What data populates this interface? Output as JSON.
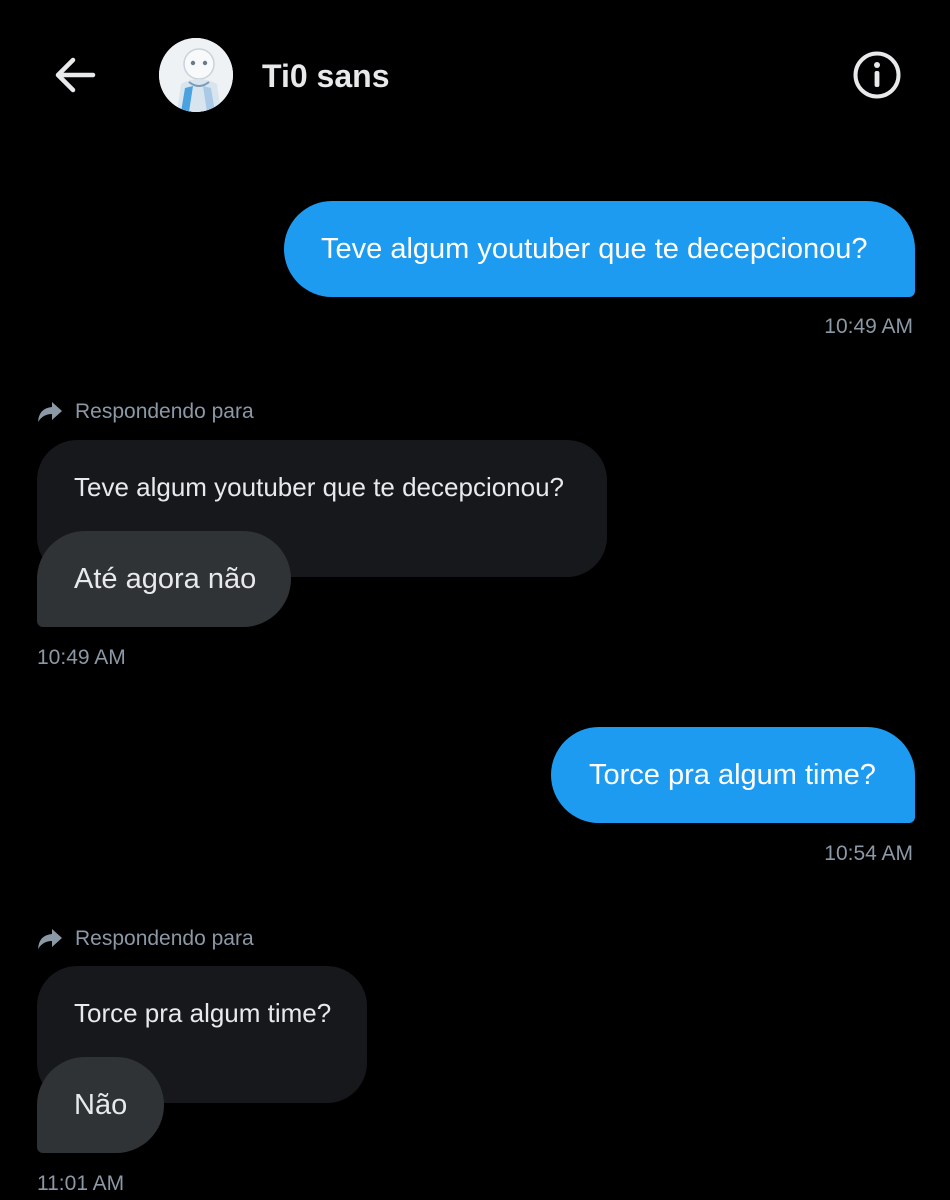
{
  "header": {
    "contact_name": "Ti0 sans",
    "back_icon": "arrow-left-icon",
    "info_icon": "info-circle-icon"
  },
  "colors": {
    "background": "#000000",
    "outgoing_bubble": "#1d9bf0",
    "incoming_bubble": "#2f3336",
    "quoted_bubble": "#16181c",
    "meta_text": "#8b98a5"
  },
  "messages": [
    {
      "direction": "outgoing",
      "text": "Teve algum youtuber que te decepcionou?",
      "time": "10:49 AM"
    },
    {
      "direction": "incoming",
      "reply_label": "Respondendo para",
      "quoted_text": "Teve algum youtuber que te decepcionou?",
      "text": "Até agora não",
      "time": "10:49 AM"
    },
    {
      "direction": "outgoing",
      "text": "Torce pra algum time?",
      "time": "10:54 AM"
    },
    {
      "direction": "incoming",
      "reply_label": "Respondendo para",
      "quoted_text": "Torce pra algum time?",
      "text": "Não",
      "time": "11:01 AM"
    }
  ]
}
